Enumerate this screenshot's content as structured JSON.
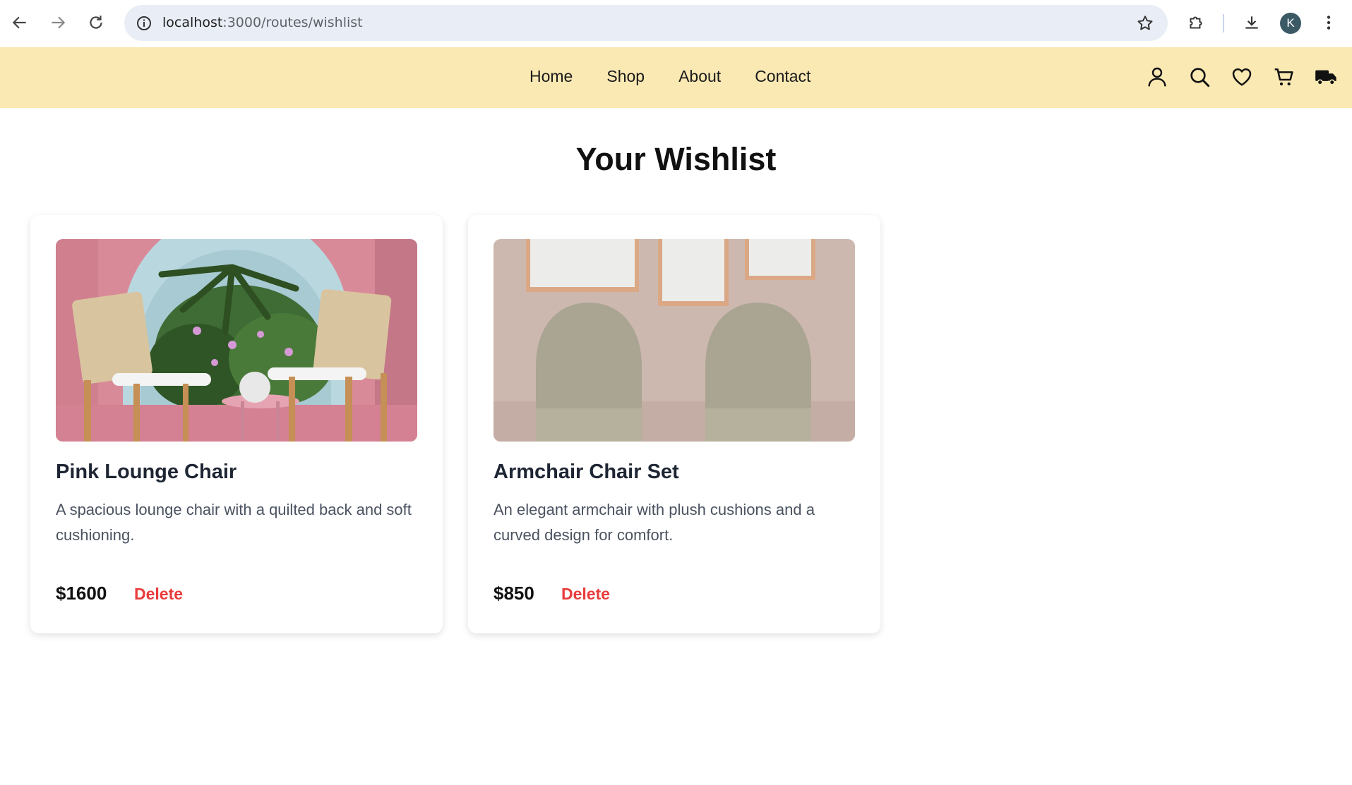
{
  "browser": {
    "url_host": "localhost",
    "url_path": ":3000/routes/wishlist",
    "profile_initial": "K"
  },
  "header": {
    "nav": [
      "Home",
      "Shop",
      "About",
      "Contact"
    ],
    "icons": [
      "user-icon",
      "search-icon",
      "heart-icon",
      "cart-icon",
      "truck-icon"
    ]
  },
  "main": {
    "title": "Your Wishlist",
    "items": [
      {
        "name": "Pink Lounge Chair",
        "description": "A spacious lounge chair with a quilted back and soft cushioning.",
        "price": "$1600",
        "delete_label": "Delete"
      },
      {
        "name": "Armchair Chair Set",
        "description": "An elegant armchair with plush cushions and a curved design for comfort.",
        "price": "$850",
        "delete_label": "Delete"
      }
    ]
  },
  "colors": {
    "header_bg": "#fbe9b4",
    "delete": "#ea3b3b",
    "omnibox_bg": "#e9eef6"
  }
}
